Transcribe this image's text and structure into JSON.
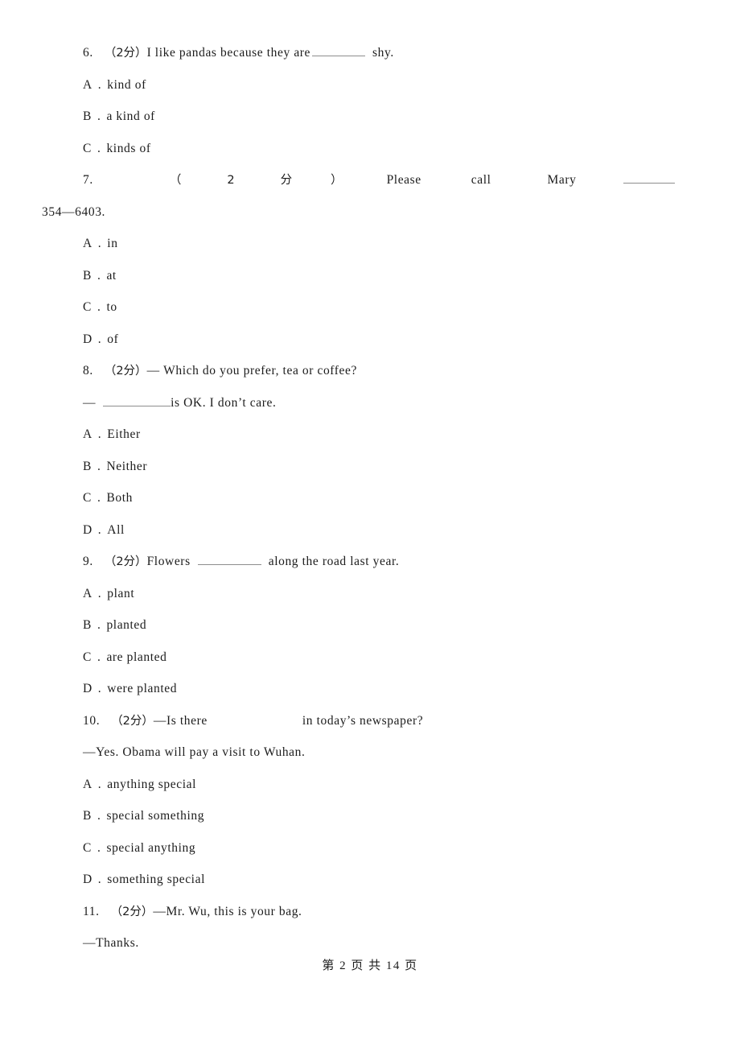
{
  "document": {
    "type": "exam-paper",
    "page_label": "第 2 页 共 14 页",
    "footer": {
      "prefix": "第",
      "current_page": "2",
      "middle": "页 共",
      "total_pages": "14",
      "suffix": "页"
    }
  },
  "questions": [
    {
      "number": "6.",
      "marks": "（2分）",
      "stem_before": "I like pandas because they are",
      "stem_after": "shy.",
      "blank": "underline",
      "options": [
        {
          "letter": "A",
          "sep": ".",
          "text": "kind of"
        },
        {
          "letter": "B",
          "sep": ".",
          "text": "a kind of"
        },
        {
          "letter": "C",
          "sep": ".",
          "text": "kinds of"
        }
      ]
    },
    {
      "number": "7.",
      "marks_parts": [
        "（",
        "2",
        "分",
        "）"
      ],
      "justified_words": [
        "Please",
        "call",
        "Mary"
      ],
      "stem_second_line": "354—6403.",
      "options": [
        {
          "letter": "A",
          "sep": ".",
          "text": "in"
        },
        {
          "letter": "B",
          "sep": ".",
          "text": "at"
        },
        {
          "letter": "C",
          "sep": ".",
          "text": "to"
        },
        {
          "letter": "D",
          "sep": ".",
          "text": "of"
        }
      ]
    },
    {
      "number": "8.",
      "marks": "（2分）",
      "stem_line1": "— Which do you prefer, tea or coffee?",
      "stem_line2_dash": "—",
      "stem_line2_after": "is OK. I don’t care.",
      "options": [
        {
          "letter": "A",
          "sep": ".",
          "text": "Either"
        },
        {
          "letter": "B",
          "sep": ".",
          "text": "Neither"
        },
        {
          "letter": "C",
          "sep": ".",
          "text": "Both"
        },
        {
          "letter": "D",
          "sep": ".",
          "text": "All"
        }
      ]
    },
    {
      "number": "9.",
      "marks": "（2分）",
      "stem_before": "Flowers",
      "stem_after": "along the road last year.",
      "blank": "underline",
      "options": [
        {
          "letter": "A",
          "sep": ".",
          "text": "plant"
        },
        {
          "letter": "B",
          "sep": ".",
          "text": "planted"
        },
        {
          "letter": "C",
          "sep": ".",
          "text": "are planted"
        },
        {
          "letter": "D",
          "sep": ".",
          "text": "were planted"
        }
      ]
    },
    {
      "number": "10.",
      "marks": "（2分）",
      "stem_before": "—Is there",
      "stem_after": "in today’s newspaper?",
      "blank": "space",
      "stem_line2": "—Yes. Obama will pay a visit to Wuhan.",
      "options": [
        {
          "letter": "A",
          "sep": ".",
          "text": "anything special"
        },
        {
          "letter": "B",
          "sep": ".",
          "text": "special something"
        },
        {
          "letter": "C",
          "sep": ".",
          "text": "special anything"
        },
        {
          "letter": "D",
          "sep": ".",
          "text": "something special"
        }
      ]
    },
    {
      "number": "11.",
      "marks": "（2分）",
      "stem_line1": "—Mr. Wu, this is your bag.",
      "stem_line2": "—Thanks."
    }
  ]
}
